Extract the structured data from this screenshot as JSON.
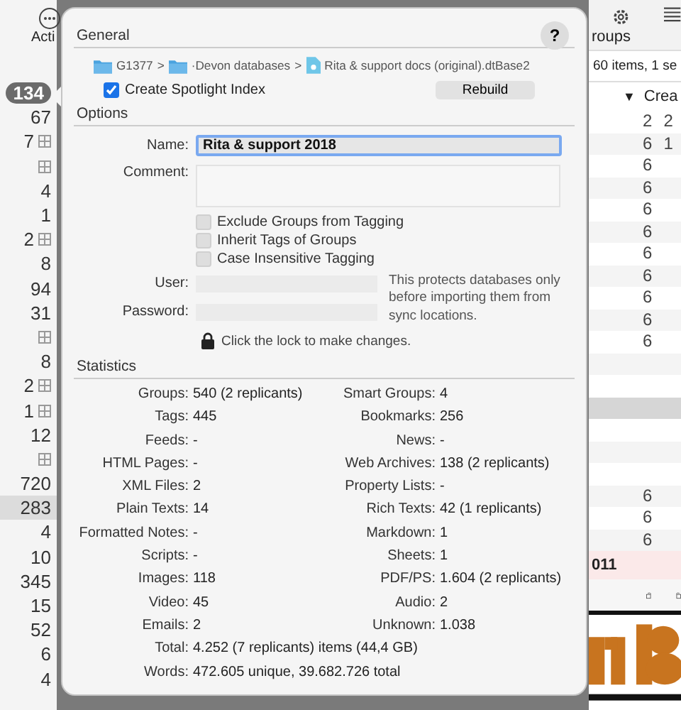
{
  "toolbar": {
    "action_label": "Acti",
    "groups_label": "roups",
    "item_count": "60 items, 1 se",
    "sort_indicator": "▼",
    "column_header": "Crea"
  },
  "sidebar_counts": [
    {
      "count": "134",
      "kind": "badge",
      "grid": false,
      "selected": false
    },
    {
      "count": "67",
      "kind": "plain",
      "grid": false,
      "selected": false
    },
    {
      "count": "7",
      "kind": "plain",
      "grid": true,
      "selected": false
    },
    {
      "grid": true,
      "selected": false
    },
    {
      "count": "4",
      "kind": "plain",
      "grid": false,
      "selected": false
    },
    {
      "count": "1",
      "kind": "plain",
      "grid": false,
      "selected": false
    },
    {
      "count": "2",
      "kind": "plain",
      "grid": true,
      "selected": false
    },
    {
      "count": "8",
      "kind": "plain",
      "grid": false,
      "selected": false
    },
    {
      "count": "94",
      "kind": "plain",
      "grid": false,
      "selected": false
    },
    {
      "count": "31",
      "kind": "plain",
      "grid": false,
      "selected": false
    },
    {
      "grid": true,
      "selected": false
    },
    {
      "count": "8",
      "kind": "plain",
      "grid": false,
      "selected": false
    },
    {
      "count": "2",
      "kind": "plain",
      "grid": true,
      "selected": false
    },
    {
      "count": "1",
      "kind": "plain",
      "grid": true,
      "selected": false
    },
    {
      "count": "12",
      "kind": "plain",
      "grid": false,
      "selected": false
    },
    {
      "grid": true,
      "selected": false
    },
    {
      "count": "720",
      "kind": "plain",
      "grid": false,
      "selected": false
    },
    {
      "count": "283",
      "kind": "plain",
      "grid": false,
      "selected": true
    },
    {
      "count": "4",
      "kind": "plain",
      "grid": false,
      "selected": false
    },
    {
      "count": "10",
      "kind": "plain",
      "grid": false,
      "selected": false
    },
    {
      "count": "345",
      "kind": "plain",
      "grid": false,
      "selected": false
    },
    {
      "count": "15",
      "kind": "plain",
      "grid": false,
      "selected": false
    },
    {
      "count": "52",
      "kind": "plain",
      "grid": false,
      "selected": false
    },
    {
      "count": "6",
      "kind": "plain",
      "grid": false,
      "selected": false
    },
    {
      "count": "4",
      "kind": "plain",
      "grid": false,
      "selected": false
    }
  ],
  "list_rows": [
    {
      "cells": [
        "2",
        "2"
      ],
      "selected": false
    },
    {
      "cells": [
        "6",
        "1"
      ],
      "selected": false
    },
    {
      "cells": [
        "6"
      ],
      "selected": false
    },
    {
      "cells": [
        "6"
      ],
      "selected": false
    },
    {
      "cells": [
        "6"
      ],
      "selected": false
    },
    {
      "cells": [
        "6"
      ],
      "selected": false
    },
    {
      "cells": [
        "6"
      ],
      "selected": false
    },
    {
      "cells": [
        "6"
      ],
      "selected": false
    },
    {
      "cells": [
        "6"
      ],
      "selected": false
    },
    {
      "cells": [
        "6"
      ],
      "selected": false
    },
    {
      "cells": [
        "6"
      ],
      "selected": false
    },
    {
      "selected": false
    },
    {
      "selected": false
    },
    {
      "selected": true
    },
    {
      "selected": false
    },
    {
      "selected": false
    },
    {
      "selected": false
    },
    {
      "cells": [
        "6"
      ],
      "selected": false
    },
    {
      "cells": [
        "6"
      ],
      "selected": false
    },
    {
      "cells": [
        "6"
      ],
      "selected": false
    }
  ],
  "highlight_row": "011",
  "popover": {
    "help": "?",
    "general": {
      "heading": "General",
      "path": [
        {
          "label": "G1377",
          "kind": "folder"
        },
        {
          "label": "·Devon databases",
          "kind": "folder"
        },
        {
          "label": "Rita & support docs (original).dtBase2",
          "kind": "database"
        }
      ],
      "separator": ">",
      "spotlight": {
        "label": "Create Spotlight Index",
        "checked": true
      },
      "rebuild": "Rebuild"
    },
    "options": {
      "heading": "Options",
      "name_label": "Name:",
      "name_value": "Rita & support 2018",
      "comment_label": "Comment:",
      "checks": [
        {
          "label": "Exclude Groups from Tagging",
          "checked": false
        },
        {
          "label": "Inherit Tags of Groups",
          "checked": false
        },
        {
          "label": "Case Insensitive Tagging",
          "checked": false
        }
      ],
      "user_label": "User:",
      "password_label": "Password:",
      "note": "This protects databases only before importing them from sync locations.",
      "lock_text": "Click the lock to make changes."
    },
    "statistics": {
      "heading": "Statistics",
      "pairs": [
        [
          {
            "label": "Groups:",
            "value": "540 (2 replicants)"
          },
          {
            "label": "Smart Groups:",
            "value": "4"
          }
        ],
        [
          {
            "label": "Tags:",
            "value": "445"
          },
          {
            "label": "Bookmarks:",
            "value": "256"
          }
        ],
        [
          {
            "label": "Feeds:",
            "value": "-"
          },
          {
            "label": "News:",
            "value": "-"
          }
        ],
        [
          {
            "label": "HTML Pages:",
            "value": "-"
          },
          {
            "label": "Web Archives:",
            "value": "138 (2 replicants)"
          }
        ],
        [
          {
            "label": "XML Files:",
            "value": "2"
          },
          {
            "label": "Property Lists:",
            "value": "-"
          }
        ],
        [
          {
            "label": "Plain Texts:",
            "value": "14"
          },
          {
            "label": "Rich Texts:",
            "value": "42 (1 replicants)"
          }
        ],
        [
          {
            "label": "Formatted Notes:",
            "value": "-"
          },
          {
            "label": "Markdown:",
            "value": "1"
          }
        ],
        [
          {
            "label": "Scripts:",
            "value": "-"
          },
          {
            "label": "Sheets:",
            "value": "1"
          }
        ],
        [
          {
            "label": "Images:",
            "value": "118"
          },
          {
            "label": "PDF/PS:",
            "value": "1.604 (2 replicants)"
          }
        ],
        [
          {
            "label": "Video:",
            "value": "45"
          },
          {
            "label": "Audio:",
            "value": "2"
          }
        ],
        [
          {
            "label": "Emails:",
            "value": "2"
          },
          {
            "label": "Unknown:",
            "value": "1.038"
          }
        ]
      ],
      "totals": [
        {
          "label": "Total:",
          "value": "4.252 (7 replicants) items (44,4 GB)"
        },
        {
          "label": "Words:",
          "value": "472.605 unique, 39.682.726 total"
        }
      ]
    }
  }
}
